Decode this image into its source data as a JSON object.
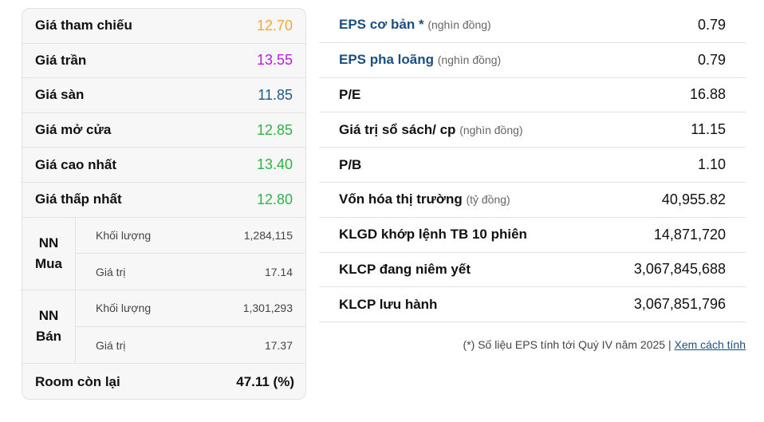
{
  "left": {
    "rows": [
      {
        "label": "Giá tham chiếu",
        "value": "12.70",
        "color": "#f5a53c"
      },
      {
        "label": "Giá trần",
        "value": "13.55",
        "color": "#b51ee0"
      },
      {
        "label": "Giá sàn",
        "value": "11.85",
        "color": "#1b5a8a"
      },
      {
        "label": "Giá mở cửa",
        "value": "12.85",
        "color": "#2fb344"
      },
      {
        "label": "Giá cao nhất",
        "value": "13.40",
        "color": "#2fb344"
      },
      {
        "label": "Giá thấp nhất",
        "value": "12.80",
        "color": "#2fb344"
      }
    ],
    "nn_buy": {
      "label_1": "NN",
      "label_2": "Mua",
      "volume_label": "Khối lượng",
      "volume": "1,284,115",
      "value_label": "Giá trị",
      "value": "17.14"
    },
    "nn_sell": {
      "label_1": "NN",
      "label_2": "Bán",
      "volume_label": "Khối lượng",
      "volume": "1,301,293",
      "value_label": "Giá trị",
      "value": "17.37"
    },
    "room": {
      "label": "Room còn lại",
      "value": "47.11 (%)"
    }
  },
  "right": {
    "rows": [
      {
        "label": "EPS cơ bản *",
        "unit": "(nghìn đồng)",
        "value": "0.79"
      },
      {
        "label": "EPS pha loãng",
        "unit": "(nghìn đồng)",
        "value": "0.79"
      },
      {
        "label": "P/E",
        "unit": "",
        "value": "16.88"
      },
      {
        "label": "Giá trị sổ sách/ cp",
        "unit": "(nghìn đồng)",
        "value": "11.15"
      },
      {
        "label": "P/B",
        "unit": "",
        "value": "1.10"
      },
      {
        "label": "Vốn hóa thị trường",
        "unit": "(tỷ đồng)",
        "value": "40,955.82"
      },
      {
        "label": "KLGD khớp lệnh TB 10 phiên",
        "unit": "",
        "value": "14,871,720"
      },
      {
        "label": "KLCP đang niêm yết",
        "unit": "",
        "value": "3,067,845,688"
      },
      {
        "label": "KLCP lưu hành",
        "unit": "",
        "value": "3,067,851,796"
      }
    ],
    "note": "(*) Số liệu EPS tính tới Quý IV năm 2025 |",
    "note_link": "Xem cách tính"
  }
}
